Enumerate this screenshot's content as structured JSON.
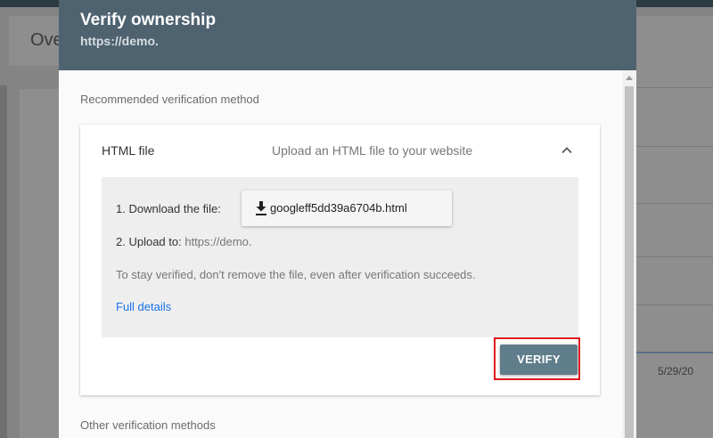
{
  "background": {
    "page_title": "Ove",
    "date": "5/29/20"
  },
  "dialog": {
    "title": "Verify ownership",
    "property": "https://demo.",
    "recommended_label": "Recommended verification method",
    "other_label": "Other verification methods"
  },
  "method": {
    "name": "HTML file",
    "description": "Upload an HTML file to your website",
    "expanded": true,
    "step1_label": "1. Download the file:",
    "file_name": "googleff5dd39a6704b.html",
    "step2_label": "2. Upload to:",
    "step2_url": "https://demo.",
    "note": "To stay verified, don't remove the file, even after verification succeeds.",
    "details_link": "Full details",
    "verify_label": "VERIFY"
  },
  "colors": {
    "header": "#4f6270",
    "verify_button": "#607d8b",
    "highlight": "#e0141e",
    "link": "#1a73e8"
  }
}
